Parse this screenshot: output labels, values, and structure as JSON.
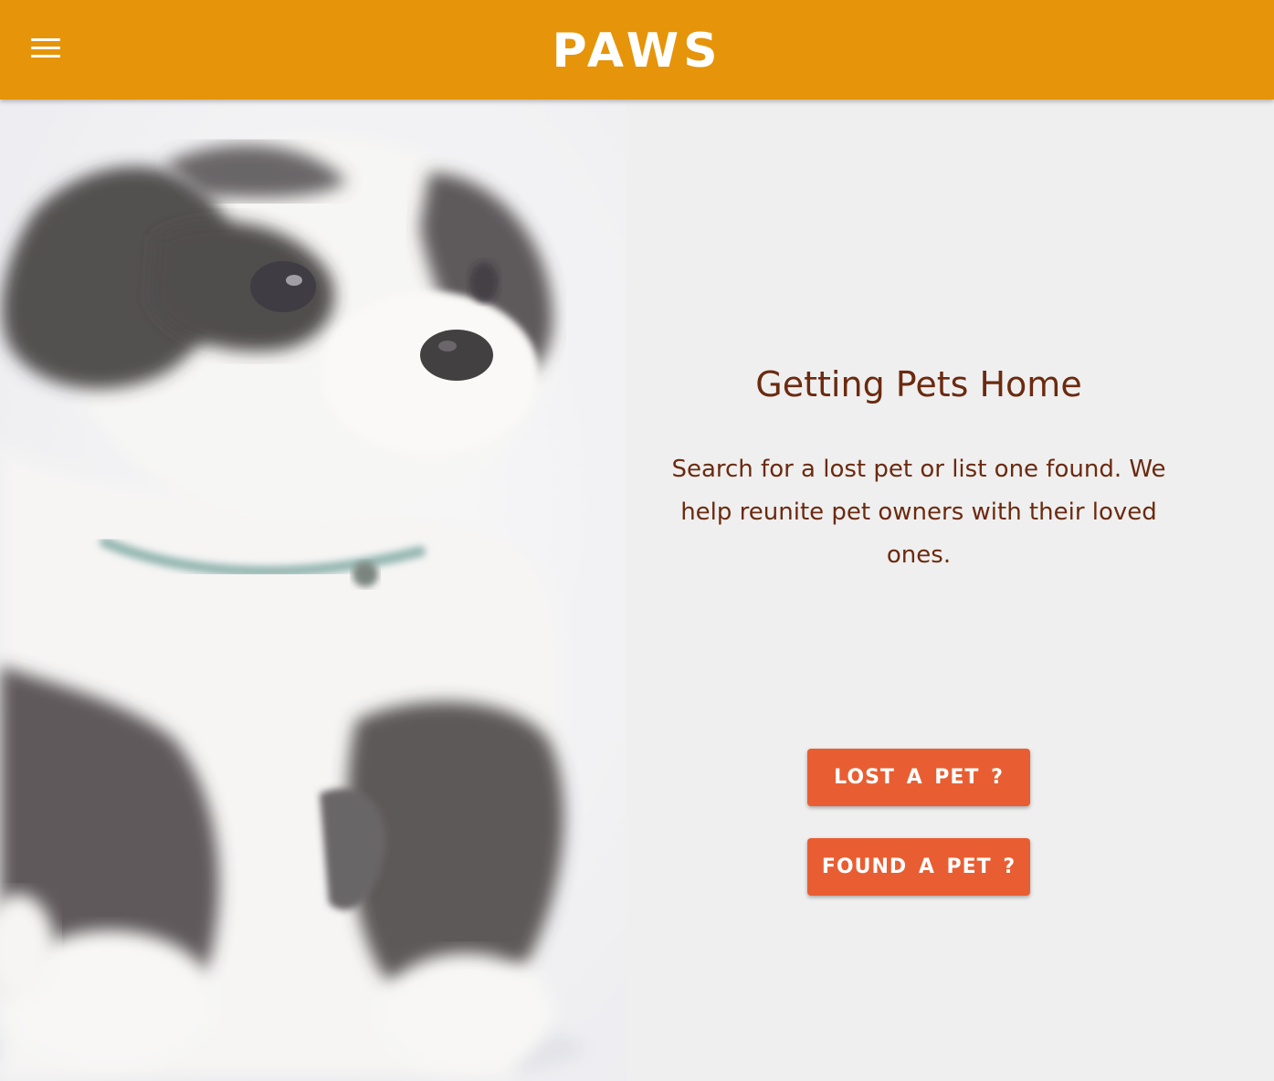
{
  "header": {
    "brand": "PAWS",
    "menu_icon": "hamburger-menu-icon",
    "background_color": "#e69409"
  },
  "hero": {
    "image": "puppy-photo",
    "headline": "Getting Pets Home",
    "tagline": "Search for a lost pet or list one found. We help reunite pet owners with their loved ones.",
    "text_color": "#6b2a0f"
  },
  "actions": {
    "lost_label": "LOST A PET ?",
    "found_label": "FOUND A PET ?",
    "button_color": "#e85e32"
  }
}
